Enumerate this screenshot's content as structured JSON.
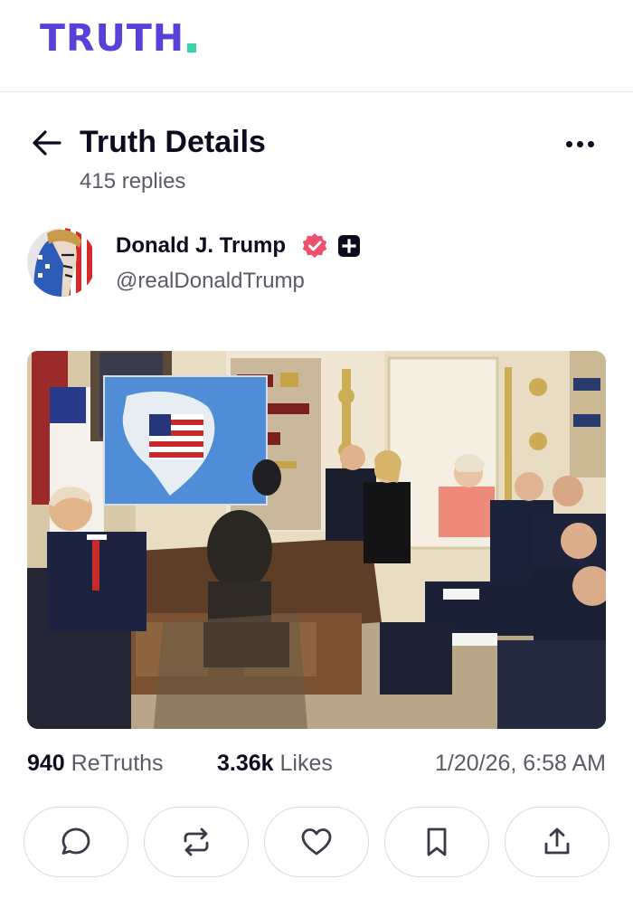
{
  "brand": {
    "logo_text": "TRUTH",
    "colors": {
      "brand": "#5a3fd9",
      "accent": "#35d3a6",
      "verified": "#ef4f6c"
    }
  },
  "header": {
    "back_icon": "arrow-left-icon",
    "title": "Truth Details",
    "replies": "415 replies",
    "more_icon": "more-horizontal-icon"
  },
  "post": {
    "author": {
      "name": "Donald J. Trump",
      "handle": "@realDonaldTrump",
      "badges": [
        "verified-badge-icon",
        "plus-badge-icon"
      ]
    },
    "image": {
      "type": "photo",
      "map_label": "US"
    },
    "stats": {
      "retruths_count": "940",
      "retruths_label": "ReTruths",
      "likes_count": "3.36k",
      "likes_label": "Likes",
      "timestamp": "1/20/26, 6:58 AM"
    },
    "actions": [
      {
        "name": "reply",
        "icon": "reply-bubble-icon"
      },
      {
        "name": "retruth",
        "icon": "repost-icon"
      },
      {
        "name": "like",
        "icon": "heart-icon"
      },
      {
        "name": "bookmark",
        "icon": "bookmark-icon"
      },
      {
        "name": "share",
        "icon": "share-upload-icon"
      }
    ]
  }
}
